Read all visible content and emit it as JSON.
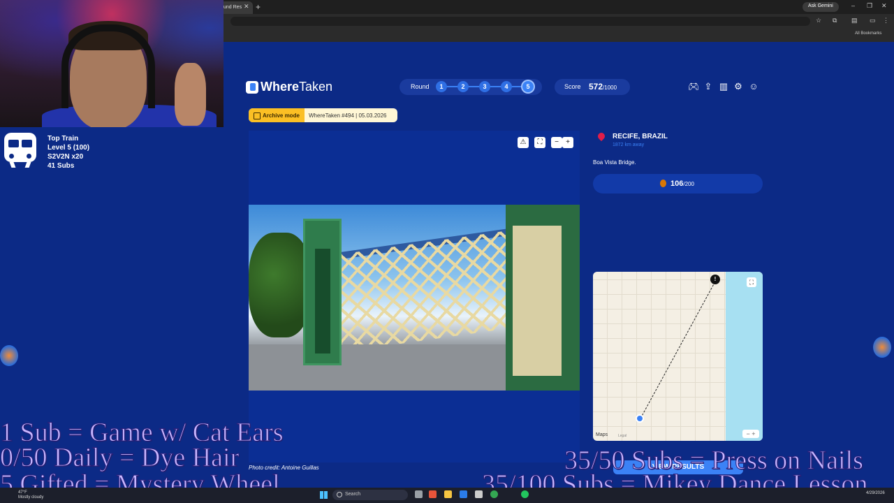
{
  "browser": {
    "tab_title": "und Res",
    "ask_gemini": "Ask Gemini",
    "bookmarks": "All Bookmarks"
  },
  "stream": {
    "top_train": {
      "title": "Top Train",
      "level": "Level 5  (100)",
      "user": "S2V2N x20",
      "subs": "41 Subs"
    },
    "goals": [
      "1 Sub = Game w/ Cat Ears",
      "0/50 Daily = Dye Hair",
      "5 Gifted = Mystery Wheel",
      "35/50 Subs = Press on Nails",
      "35/100 Subs = Mikey Dance Lesson"
    ]
  },
  "app": {
    "logo": {
      "where": "Where",
      "taken": "Taken"
    },
    "round": {
      "label": "Round",
      "numbers": [
        "1",
        "2",
        "3",
        "4",
        "5"
      ],
      "current": 5
    },
    "score": {
      "label": "Score",
      "value": "572",
      "max": "/1000"
    },
    "nav_icons": [
      "controller-icon",
      "share-icon",
      "stats-icon",
      "settings-icon",
      "profile-icon"
    ],
    "archive": {
      "tag": "Archive mode",
      "info": "WhereTaken #494 | 05.03.2026"
    },
    "photo_tools": [
      "warning-icon",
      "fullscreen-icon",
      "zoom-out-icon",
      "zoom-in-icon"
    ],
    "photo_credit": "Photo credit: Antoine Guillas",
    "answer": {
      "location": "RECIFE, BRAZIL",
      "distance": "1872 km away",
      "description": "Boa Vista Bridge.",
      "points": "106",
      "points_max": "/200"
    },
    "map": {
      "attribution": "Maps",
      "legal": "Legal",
      "answer_label": "Location",
      "guess_label": "Your guess"
    },
    "view_results": "VIEW RESULTS"
  },
  "taskbar": {
    "weather_temp": "47°F",
    "weather_desc": "Mostly cloudy",
    "search": "Search",
    "date": "4/29/2026"
  },
  "colors": {
    "page_bg": "#0c2a86",
    "accent": "#3b82f6",
    "archive_tag": "#fbbf24",
    "goal_text": "#c7b7ff"
  }
}
